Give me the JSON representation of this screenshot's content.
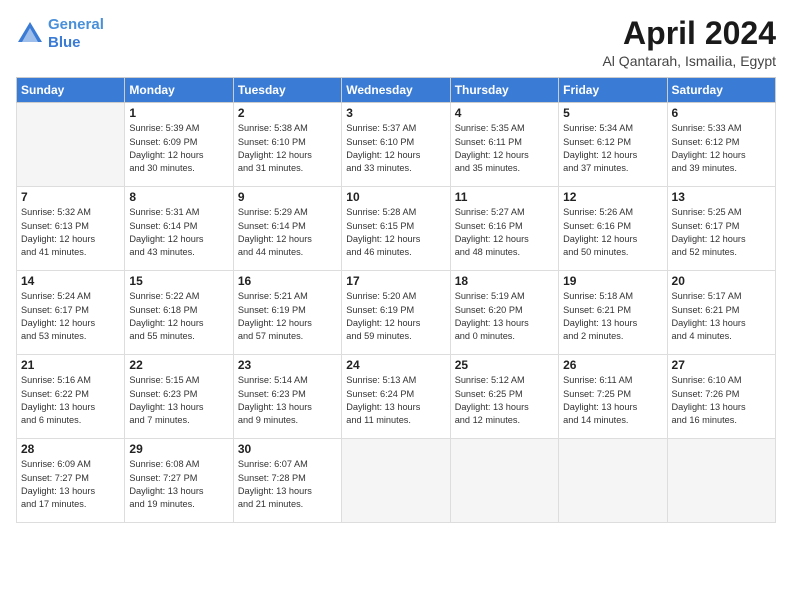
{
  "header": {
    "logo_line1": "General",
    "logo_line2": "Blue",
    "title": "April 2024",
    "subtitle": "Al Qantarah, Ismailia, Egypt"
  },
  "columns": [
    "Sunday",
    "Monday",
    "Tuesday",
    "Wednesday",
    "Thursday",
    "Friday",
    "Saturday"
  ],
  "weeks": [
    [
      {
        "num": "",
        "text": ""
      },
      {
        "num": "1",
        "text": "Sunrise: 5:39 AM\nSunset: 6:09 PM\nDaylight: 12 hours\nand 30 minutes."
      },
      {
        "num": "2",
        "text": "Sunrise: 5:38 AM\nSunset: 6:10 PM\nDaylight: 12 hours\nand 31 minutes."
      },
      {
        "num": "3",
        "text": "Sunrise: 5:37 AM\nSunset: 6:10 PM\nDaylight: 12 hours\nand 33 minutes."
      },
      {
        "num": "4",
        "text": "Sunrise: 5:35 AM\nSunset: 6:11 PM\nDaylight: 12 hours\nand 35 minutes."
      },
      {
        "num": "5",
        "text": "Sunrise: 5:34 AM\nSunset: 6:12 PM\nDaylight: 12 hours\nand 37 minutes."
      },
      {
        "num": "6",
        "text": "Sunrise: 5:33 AM\nSunset: 6:12 PM\nDaylight: 12 hours\nand 39 minutes."
      }
    ],
    [
      {
        "num": "7",
        "text": "Sunrise: 5:32 AM\nSunset: 6:13 PM\nDaylight: 12 hours\nand 41 minutes."
      },
      {
        "num": "8",
        "text": "Sunrise: 5:31 AM\nSunset: 6:14 PM\nDaylight: 12 hours\nand 43 minutes."
      },
      {
        "num": "9",
        "text": "Sunrise: 5:29 AM\nSunset: 6:14 PM\nDaylight: 12 hours\nand 44 minutes."
      },
      {
        "num": "10",
        "text": "Sunrise: 5:28 AM\nSunset: 6:15 PM\nDaylight: 12 hours\nand 46 minutes."
      },
      {
        "num": "11",
        "text": "Sunrise: 5:27 AM\nSunset: 6:16 PM\nDaylight: 12 hours\nand 48 minutes."
      },
      {
        "num": "12",
        "text": "Sunrise: 5:26 AM\nSunset: 6:16 PM\nDaylight: 12 hours\nand 50 minutes."
      },
      {
        "num": "13",
        "text": "Sunrise: 5:25 AM\nSunset: 6:17 PM\nDaylight: 12 hours\nand 52 minutes."
      }
    ],
    [
      {
        "num": "14",
        "text": "Sunrise: 5:24 AM\nSunset: 6:17 PM\nDaylight: 12 hours\nand 53 minutes."
      },
      {
        "num": "15",
        "text": "Sunrise: 5:22 AM\nSunset: 6:18 PM\nDaylight: 12 hours\nand 55 minutes."
      },
      {
        "num": "16",
        "text": "Sunrise: 5:21 AM\nSunset: 6:19 PM\nDaylight: 12 hours\nand 57 minutes."
      },
      {
        "num": "17",
        "text": "Sunrise: 5:20 AM\nSunset: 6:19 PM\nDaylight: 12 hours\nand 59 minutes."
      },
      {
        "num": "18",
        "text": "Sunrise: 5:19 AM\nSunset: 6:20 PM\nDaylight: 13 hours\nand 0 minutes."
      },
      {
        "num": "19",
        "text": "Sunrise: 5:18 AM\nSunset: 6:21 PM\nDaylight: 13 hours\nand 2 minutes."
      },
      {
        "num": "20",
        "text": "Sunrise: 5:17 AM\nSunset: 6:21 PM\nDaylight: 13 hours\nand 4 minutes."
      }
    ],
    [
      {
        "num": "21",
        "text": "Sunrise: 5:16 AM\nSunset: 6:22 PM\nDaylight: 13 hours\nand 6 minutes."
      },
      {
        "num": "22",
        "text": "Sunrise: 5:15 AM\nSunset: 6:23 PM\nDaylight: 13 hours\nand 7 minutes."
      },
      {
        "num": "23",
        "text": "Sunrise: 5:14 AM\nSunset: 6:23 PM\nDaylight: 13 hours\nand 9 minutes."
      },
      {
        "num": "24",
        "text": "Sunrise: 5:13 AM\nSunset: 6:24 PM\nDaylight: 13 hours\nand 11 minutes."
      },
      {
        "num": "25",
        "text": "Sunrise: 5:12 AM\nSunset: 6:25 PM\nDaylight: 13 hours\nand 12 minutes."
      },
      {
        "num": "26",
        "text": "Sunrise: 6:11 AM\nSunset: 7:25 PM\nDaylight: 13 hours\nand 14 minutes."
      },
      {
        "num": "27",
        "text": "Sunrise: 6:10 AM\nSunset: 7:26 PM\nDaylight: 13 hours\nand 16 minutes."
      }
    ],
    [
      {
        "num": "28",
        "text": "Sunrise: 6:09 AM\nSunset: 7:27 PM\nDaylight: 13 hours\nand 17 minutes."
      },
      {
        "num": "29",
        "text": "Sunrise: 6:08 AM\nSunset: 7:27 PM\nDaylight: 13 hours\nand 19 minutes."
      },
      {
        "num": "30",
        "text": "Sunrise: 6:07 AM\nSunset: 7:28 PM\nDaylight: 13 hours\nand 21 minutes."
      },
      {
        "num": "",
        "text": ""
      },
      {
        "num": "",
        "text": ""
      },
      {
        "num": "",
        "text": ""
      },
      {
        "num": "",
        "text": ""
      }
    ]
  ]
}
